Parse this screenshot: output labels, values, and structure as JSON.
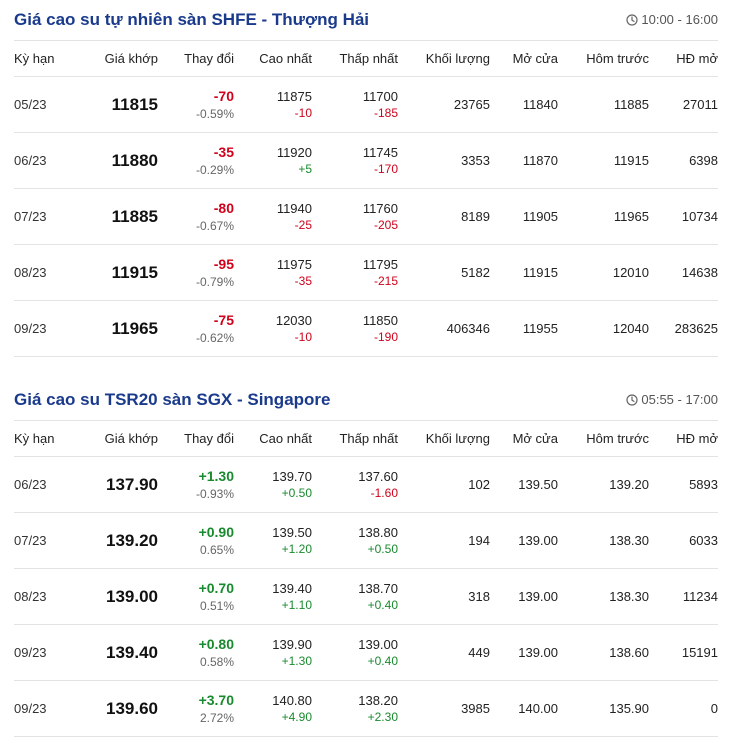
{
  "shfe": {
    "title": "Giá cao su tự nhiên sàn SHFE - Thượng Hải",
    "time": "10:00 - 16:00",
    "headers": [
      "Kỳ hạn",
      "Giá khớp",
      "Thay đổi",
      "Cao nhất",
      "Thấp nhất",
      "Khối lượng",
      "Mở cửa",
      "Hôm trước",
      "HĐ mở"
    ],
    "rows": [
      {
        "term": "05/23",
        "price": "11815",
        "change": "-70",
        "pct": "-0.59%",
        "high": "11875",
        "high_chg": "-10",
        "low": "11700",
        "low_chg": "-185",
        "volume": "23765",
        "open": "11840",
        "prev": "11885",
        "oi": "27011"
      },
      {
        "term": "06/23",
        "price": "11880",
        "change": "-35",
        "pct": "-0.29%",
        "high": "11920",
        "high_chg": "+5",
        "low": "11745",
        "low_chg": "-170",
        "volume": "3353",
        "open": "11870",
        "prev": "11915",
        "oi": "6398"
      },
      {
        "term": "07/23",
        "price": "11885",
        "change": "-80",
        "pct": "-0.67%",
        "high": "11940",
        "high_chg": "-25",
        "low": "11760",
        "low_chg": "-205",
        "volume": "8189",
        "open": "11905",
        "prev": "11965",
        "oi": "10734"
      },
      {
        "term": "08/23",
        "price": "11915",
        "change": "-95",
        "pct": "-0.79%",
        "high": "11975",
        "high_chg": "-35",
        "low": "11795",
        "low_chg": "-215",
        "volume": "5182",
        "open": "11915",
        "prev": "12010",
        "oi": "14638"
      },
      {
        "term": "09/23",
        "price": "11965",
        "change": "-75",
        "pct": "-0.62%",
        "high": "12030",
        "high_chg": "-10",
        "low": "11850",
        "low_chg": "-190",
        "volume": "406346",
        "open": "11955",
        "prev": "12040",
        "oi": "283625"
      }
    ]
  },
  "sgx": {
    "title": "Giá cao su TSR20 sàn SGX - Singapore",
    "time": "05:55 - 17:00",
    "headers": [
      "Kỳ hạn",
      "Giá khớp",
      "Thay đổi",
      "Cao nhất",
      "Thấp nhất",
      "Khối lượng",
      "Mở cửa",
      "Hôm trước",
      "HĐ mở"
    ],
    "rows": [
      {
        "term": "06/23",
        "price": "137.90",
        "change": "+1.30",
        "pct": "-0.93%",
        "high": "139.70",
        "high_chg": "+0.50",
        "low": "137.60",
        "low_chg": "-1.60",
        "volume": "102",
        "open": "139.50",
        "prev": "139.20",
        "oi": "5893"
      },
      {
        "term": "07/23",
        "price": "139.20",
        "change": "+0.90",
        "pct": "0.65%",
        "high": "139.50",
        "high_chg": "+1.20",
        "low": "138.80",
        "low_chg": "+0.50",
        "volume": "194",
        "open": "139.00",
        "prev": "138.30",
        "oi": "6033"
      },
      {
        "term": "08/23",
        "price": "139.00",
        "change": "+0.70",
        "pct": "0.51%",
        "high": "139.40",
        "high_chg": "+1.10",
        "low": "138.70",
        "low_chg": "+0.40",
        "volume": "318",
        "open": "139.00",
        "prev": "138.30",
        "oi": "11234"
      },
      {
        "term": "09/23",
        "price": "139.40",
        "change": "+0.80",
        "pct": "0.58%",
        "high": "139.90",
        "high_chg": "+1.30",
        "low": "139.00",
        "low_chg": "+0.40",
        "volume": "449",
        "open": "139.00",
        "prev": "138.60",
        "oi": "15191"
      },
      {
        "term": "09/23",
        "price": "139.60",
        "change": "+3.70",
        "pct": "2.72%",
        "high": "140.80",
        "high_chg": "+4.90",
        "low": "138.20",
        "low_chg": "+2.30",
        "volume": "3985",
        "open": "140.00",
        "prev": "135.90",
        "oi": "0"
      }
    ]
  },
  "colors": {
    "title": "#1a3a8c",
    "negative": "#d0021b",
    "positive": "#1a8a2e"
  },
  "icons": {
    "time": "clock-icon"
  }
}
